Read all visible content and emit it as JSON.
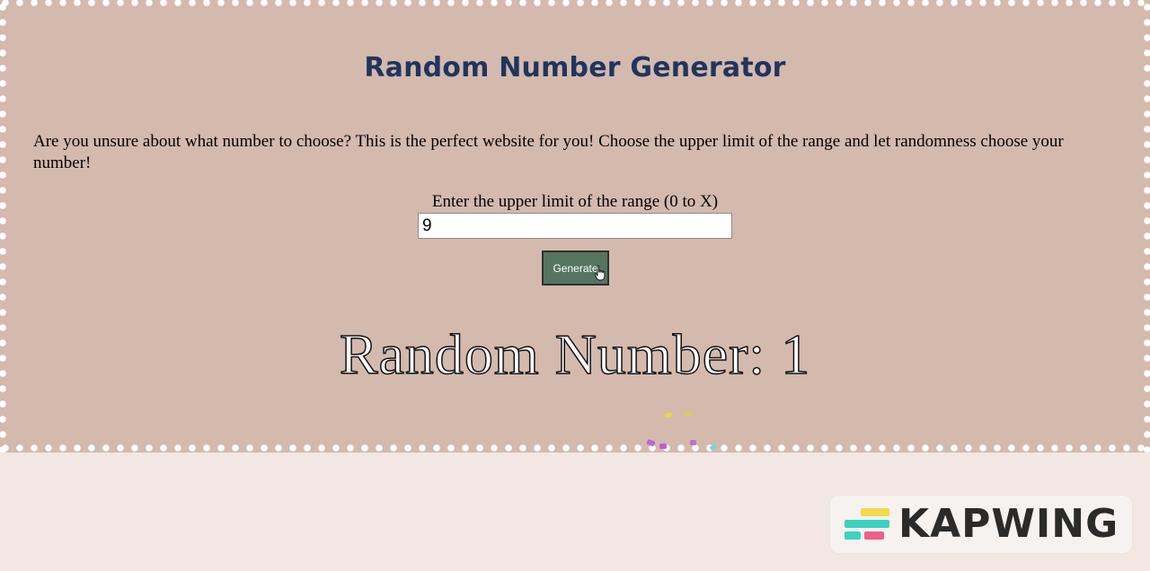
{
  "page": {
    "title": "Random Number Generator",
    "intro": "Are you unsure about what number to choose? This is the perfect website for you! Choose the upper limit of the range and let randomness choose your number!"
  },
  "form": {
    "label": "Enter the upper limit of the range (0 to X)",
    "input_value": "9",
    "button_label": "Generate"
  },
  "result": {
    "text": "Random Number: 1"
  },
  "watermark": {
    "text": "KAPWING"
  },
  "colors": {
    "stage_background": "#d4b9ad",
    "page_background": "#f2e7e1",
    "title": "#1f355e",
    "button": "#557560",
    "logo_teal": "#3bd3c0",
    "logo_yellow": "#f2d94e",
    "logo_pink": "#ef5f8a"
  },
  "icons": {
    "cursor": "hand-pointer-icon",
    "logo": "kapwing-logo-icon"
  }
}
